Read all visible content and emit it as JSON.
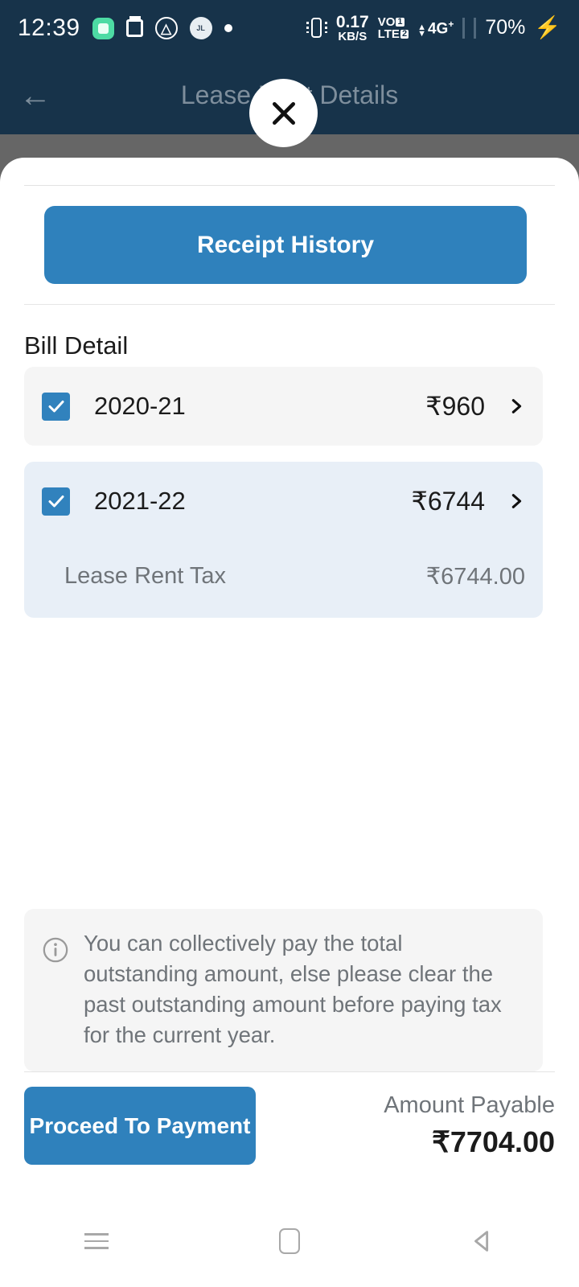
{
  "statusbar": {
    "time": "12:39",
    "icons": [
      "app-badge-icon",
      "calendar-icon",
      "triangle-circle-icon",
      "company-logo-icon",
      "dot-icon"
    ],
    "vibrate_icon": "vibrate-icon",
    "data_rate_value": "0.17",
    "data_rate_unit": "KB/S",
    "volte_top": "VO",
    "volte_bottom": "LTE",
    "sim1_badge": "1",
    "sim2_badge": "2",
    "network_type": "4G",
    "network_sup": "+",
    "battery": "70%",
    "charging_icon": "lightning-bolt-icon"
  },
  "appbar": {
    "back_icon": "arrow-left-icon",
    "title": "Lease Rent Details"
  },
  "modal": {
    "close_icon": "close-icon",
    "receipt_history_label": "Receipt History",
    "bill_detail_heading": "Bill Detail",
    "rows": [
      {
        "checked": true,
        "year": "2020-21",
        "amount": "₹960",
        "chevron_icon": "chevron-right-icon",
        "expanded": false
      },
      {
        "checked": true,
        "year": "2021-22",
        "amount": "₹6744",
        "chevron_icon": "chevron-right-icon",
        "expanded": true,
        "detail_label": "Lease Rent Tax",
        "detail_amount": "₹6744.00"
      }
    ],
    "note": {
      "icon": "info-icon",
      "text": "You can collectively pay the total outstanding amount, else please clear the past outstanding amount before paying tax for the current year."
    },
    "footer": {
      "proceed_label": "Proceed To Payment",
      "amount_label": "Amount Payable",
      "amount_value": "₹7704.00"
    }
  },
  "navbar": {
    "recents_icon": "recents-icon",
    "home_icon": "home-icon",
    "back_icon": "back-triangle-icon"
  },
  "colors": {
    "header_bg": "#17334a",
    "accent_blue": "#2f81bc",
    "checkbox_blue": "#3182bd",
    "row_gray": "#f5f5f5",
    "row_blue": "#e8eff7",
    "dim_overlay": "#666666"
  }
}
